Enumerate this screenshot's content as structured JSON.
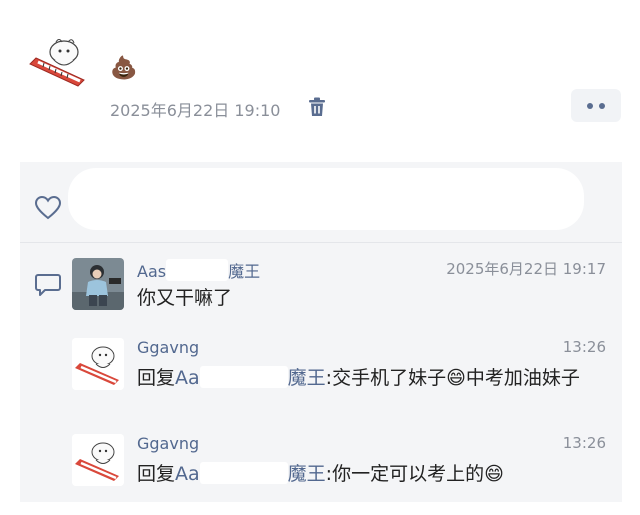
{
  "post": {
    "emoji": "💩",
    "timestamp": "2025年6月22日 19:10"
  },
  "comments": [
    {
      "name": "Aas",
      "name_suffix": "魔王",
      "time": "2025年6月22日 19:17",
      "text": "你又干嘛了"
    },
    {
      "name": "Ggavng",
      "time": "13:26",
      "reply_prefix": "回复",
      "mention_start": "Aa",
      "mention_end": "魔王",
      "text": ":交手机了妹子😄中考加油妹子"
    },
    {
      "name": "Ggavng",
      "time": "13:26",
      "reply_prefix": "回复",
      "mention_start": "Aa",
      "mention_end": "魔王",
      "text": ":你一定可以考上的😄"
    }
  ],
  "colors": {
    "name": "#52688f",
    "timestamp": "#8a8f99",
    "panel": "#f4f5f7",
    "icon": "#5a6d90"
  },
  "icons": [
    "trash-icon",
    "more-icon",
    "heart-icon",
    "comment-icon"
  ]
}
